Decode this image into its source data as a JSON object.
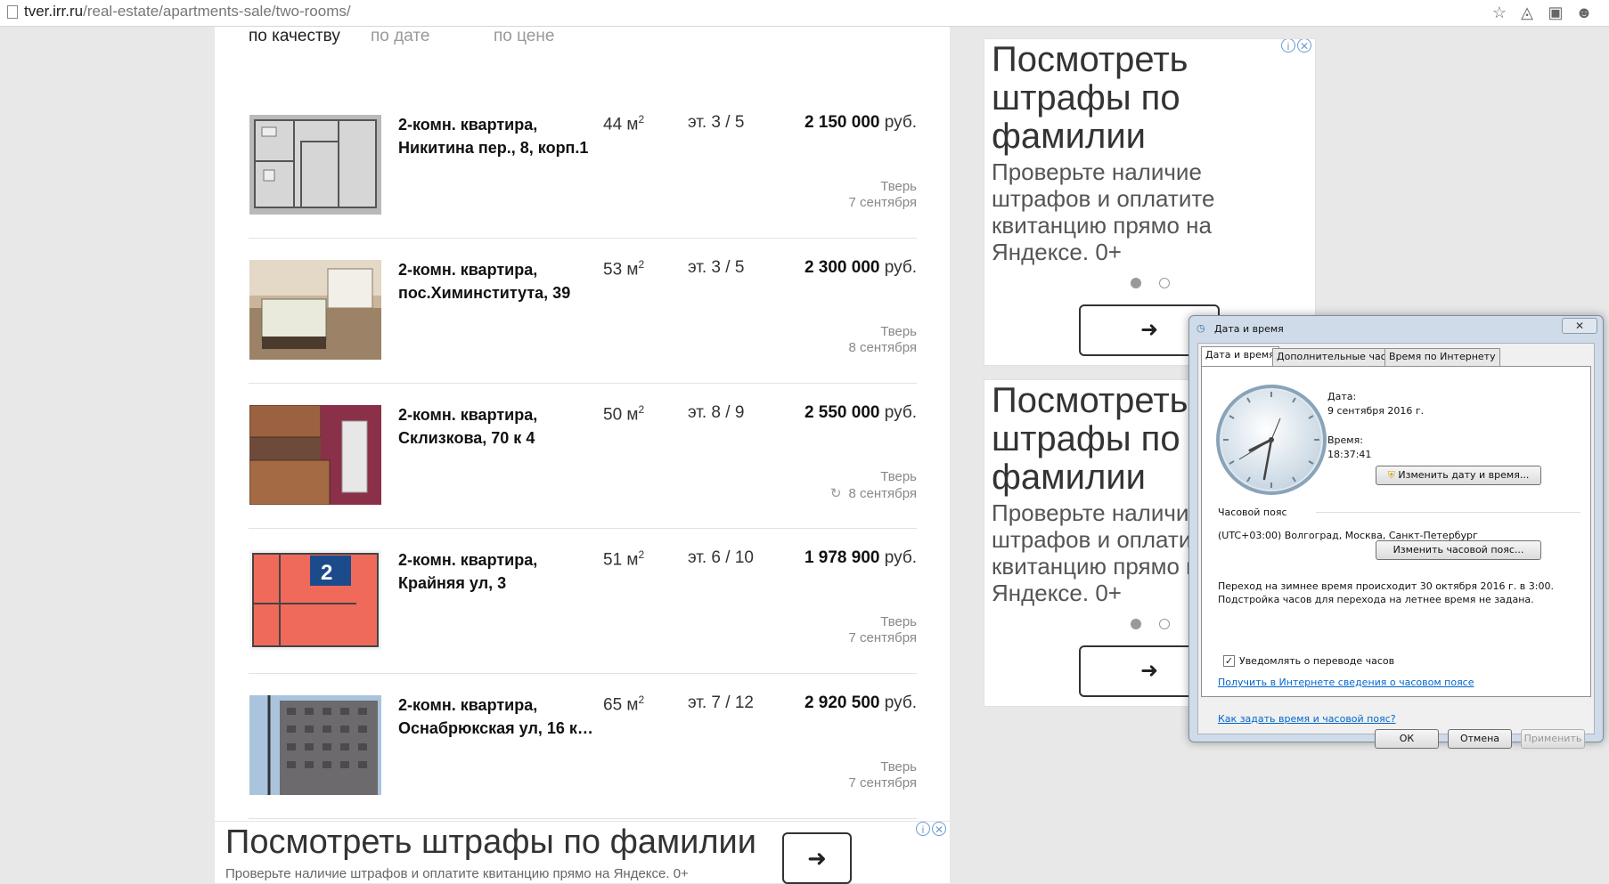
{
  "browser": {
    "url_domain": "tver.irr.ru",
    "url_path": "/real-estate/apartments-sale/two-rooms/"
  },
  "sort": {
    "by_quality": "по качеству",
    "by_date": "по дате",
    "by_price": "по цене"
  },
  "listings": [
    {
      "title": "2-комн. квартира, Никитина пер., 8, корп.1",
      "area": "44 м",
      "floor": "эт. 3 / 5",
      "price_value": "2 150 000",
      "price_unit": "руб.",
      "city": "Тверь",
      "date": "7 сентября"
    },
    {
      "title": "2-комн. квартира, пос.Химинститута, 39",
      "area": "53 м",
      "floor": "эт. 3 / 5",
      "price_value": "2 300 000",
      "price_unit": "руб.",
      "city": "Тверь",
      "date": "8 сентября"
    },
    {
      "title": "2-комн. квартира, Склизкова, 70 к 4",
      "area": "50 м",
      "floor": "эт. 8 / 9",
      "price_value": "2 550 000",
      "price_unit": "руб.",
      "city": "Тверь",
      "date": "8 сентября"
    },
    {
      "title": "2-комн. квартира, Крайняя ул, 3",
      "area": "51 м",
      "floor": "эт. 6 / 10",
      "price_value": "1 978 900",
      "price_unit": "руб.",
      "city": "Тверь",
      "date": "7 сентября"
    },
    {
      "title": "2-комн. квартира, Оснабрюкская ул, 16 к…",
      "area": "65 м",
      "floor": "эт. 7 / 12",
      "price_value": "2 920 500",
      "price_unit": "руб.",
      "city": "Тверь",
      "date": "7 сентября"
    }
  ],
  "area_sup": "2",
  "floorplan_room_number": "2",
  "ads": {
    "title": "Посмотреть штрафы по фамилии",
    "subtitle": "Проверьте наличие штрафов и оплатите квитанцию прямо на Яндексе. 0+",
    "arrow": "➜",
    "info": "i",
    "close": "✕"
  },
  "dialog": {
    "title": "Дата и время",
    "close": "✕",
    "tabs": [
      "Дата и время",
      "Дополнительные часы",
      "Время по Интернету"
    ],
    "date_label": "Дата:",
    "date_value": "9 сентября 2016 г.",
    "time_label": "Время:",
    "time_value": "18:37:41",
    "change_datetime": "Изменить дату и время...",
    "timezone_label": "Часовой пояс",
    "timezone_value": "(UTC+03:00) Волгоград, Москва, Санкт-Петербург",
    "change_timezone": "Изменить часовой пояс...",
    "dst_line1": "Переход на зимнее время происходит 30 октября 2016 г. в 3:00.",
    "dst_line2": "Подстройка часов для перехода на летнее время не задана.",
    "notify_label": "Уведомлять о переводе часов",
    "notify_checked": "✓",
    "link1": "Получить в Интернете сведения о часовом поясе",
    "link2": "Как задать время и часовой пояс?",
    "ok": "ОК",
    "cancel": "Отмена",
    "apply": "Применить"
  },
  "icons": {
    "page": "page-icon",
    "star": "star-icon",
    "refresh": "↻",
    "shield": "⛨"
  }
}
